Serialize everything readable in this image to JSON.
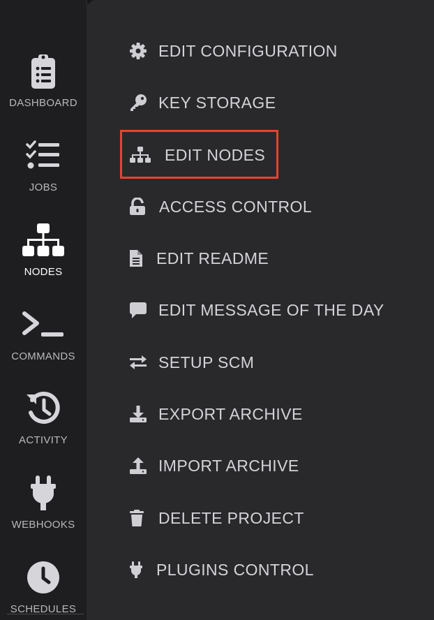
{
  "sidebar": {
    "items": [
      {
        "label": "DASHBOARD",
        "icon": "clipboard-list-icon"
      },
      {
        "label": "JOBS",
        "icon": "tasks-icon"
      },
      {
        "label": "NODES",
        "icon": "sitemap-icon",
        "active": true
      },
      {
        "label": "COMMANDS",
        "icon": "terminal-icon"
      },
      {
        "label": "ACTIVITY",
        "icon": "history-icon"
      },
      {
        "label": "WEBHOOKS",
        "icon": "plug-icon"
      },
      {
        "label": "SCHEDULES",
        "icon": "clock-icon"
      }
    ]
  },
  "menu": {
    "items": [
      {
        "label": "EDIT CONFIGURATION",
        "icon": "gear-icon"
      },
      {
        "label": "KEY STORAGE",
        "icon": "key-icon"
      },
      {
        "label": "EDIT NODES",
        "icon": "sitemap-icon",
        "highlighted": true
      },
      {
        "label": "ACCESS CONTROL",
        "icon": "unlock-icon"
      },
      {
        "label": "EDIT README",
        "icon": "file-icon"
      },
      {
        "label": "EDIT MESSAGE OF THE DAY",
        "icon": "comment-icon"
      },
      {
        "label": "SETUP SCM",
        "icon": "exchange-icon"
      },
      {
        "label": "EXPORT ARCHIVE",
        "icon": "download-icon"
      },
      {
        "label": "IMPORT ARCHIVE",
        "icon": "upload-icon"
      },
      {
        "label": "DELETE PROJECT",
        "icon": "trash-icon"
      },
      {
        "label": "PLUGINS CONTROL",
        "icon": "plug-icon"
      }
    ]
  },
  "colors": {
    "highlight_border": "#e8432f",
    "menu_text": "#d4d4d8",
    "sidebar_text": "#b9b9bd",
    "panel_background": "#29292c"
  }
}
